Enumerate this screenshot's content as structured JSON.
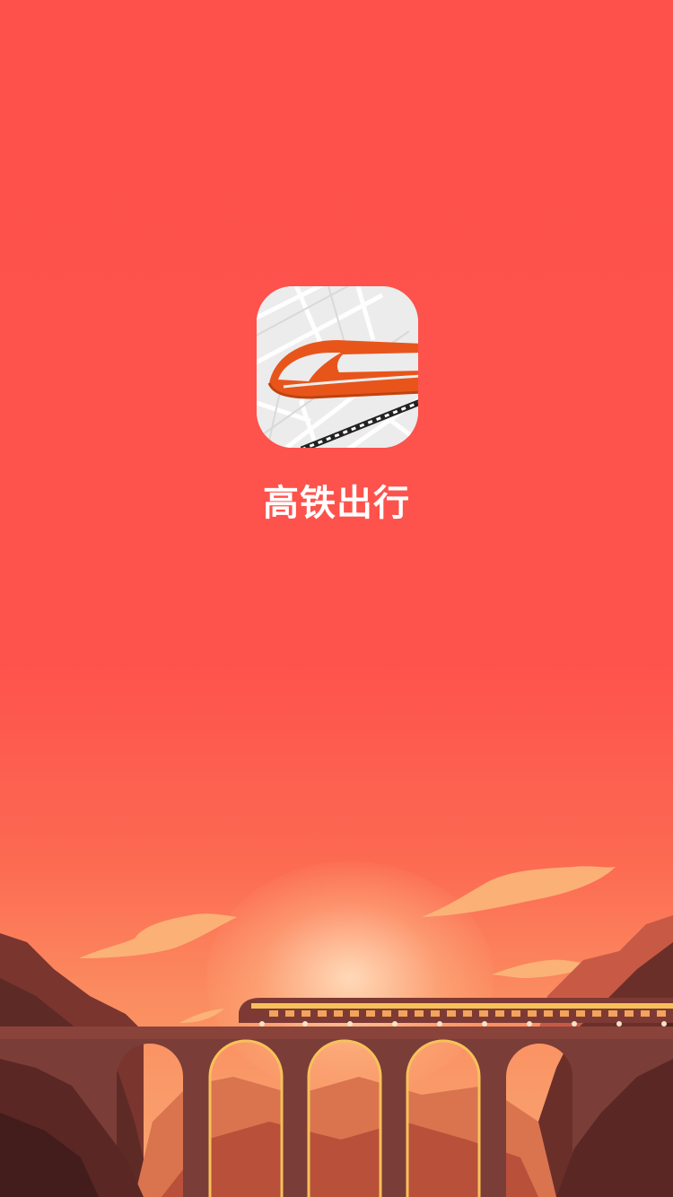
{
  "app": {
    "name": "高铁出行",
    "icon": "high-speed-train-icon"
  },
  "illustration": {
    "subject": "train-on-viaduct-at-sunset",
    "colors": {
      "background_top": "#fe514c",
      "background_bottom": "#f7a772",
      "train_body": "#7d3a35",
      "train_stripe": "#f7c15a",
      "bridge": "#7b3d37",
      "cliff_dark": "#5e2a26",
      "cloud": "#fbb77a"
    }
  }
}
